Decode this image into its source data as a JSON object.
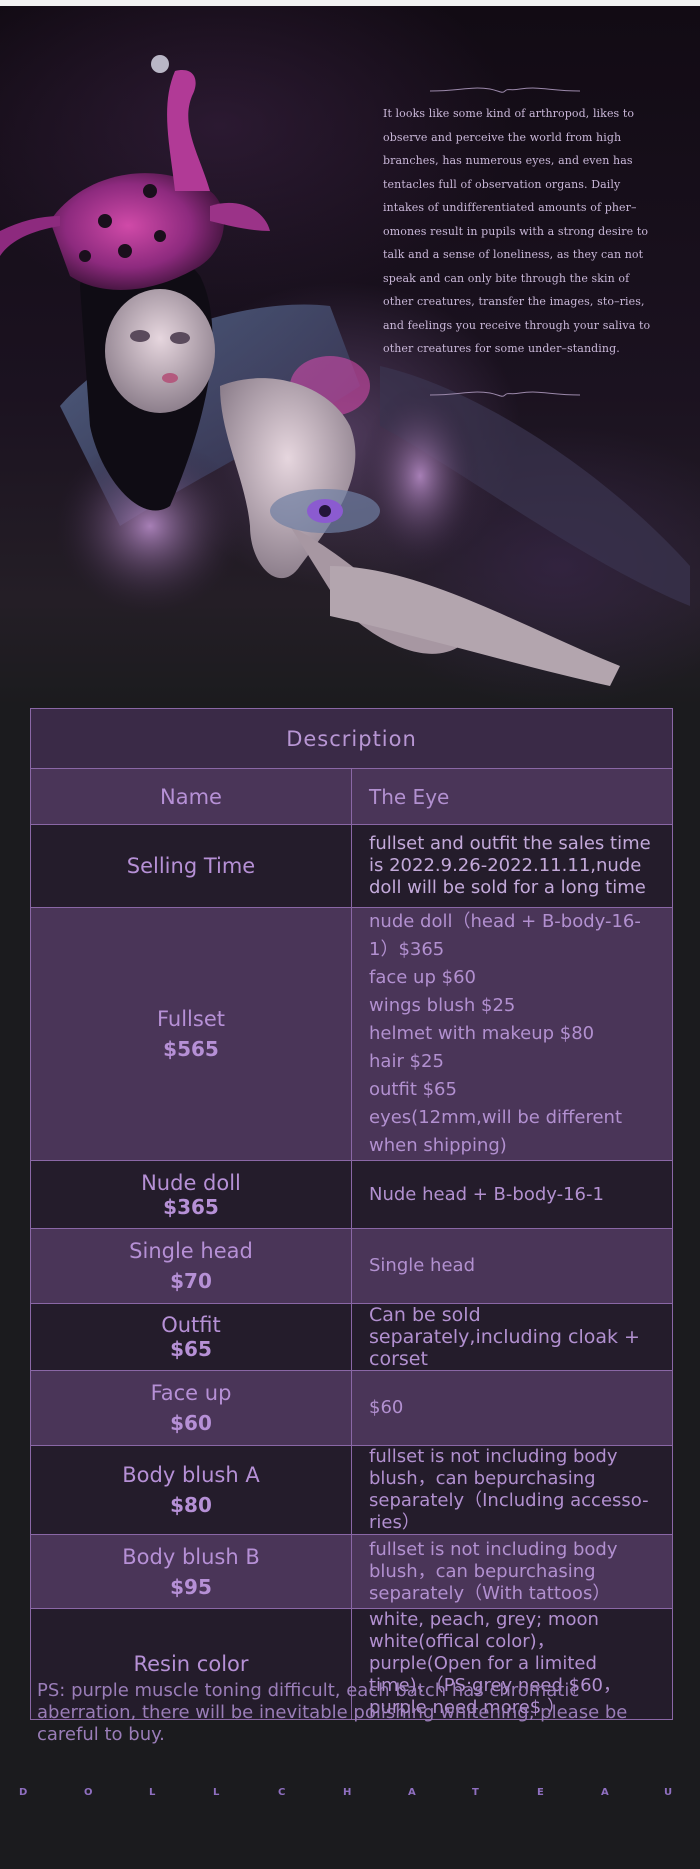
{
  "story": {
    "text": "It looks like some kind of arthropod, likes to observe and perceive the world from high branches, has numerous eyes, and even has tentacles full of observation organs. Daily intakes of undifferentiated amounts of pher–omones result in pupils with a strong desire to talk and a sense of loneliness, as they can not speak and can only bite through the skin of other creatures, transfer the images, sto–ries, and feelings you receive through your saliva to other creatures for some under–standing."
  },
  "table": {
    "heading": "Description",
    "name_label": "Name",
    "name_value": "The Eye",
    "selling_label": "Selling Time",
    "selling_value": "fullset and outfit the sales time is 2022.9.26-2022.11.11,nude doll will be sold for a long time",
    "fullset_label": "Fullset",
    "fullset_price": "$565",
    "fullset_items": [
      "nude doll（head + B-body-16-1）$365",
      "face up $60",
      "wings blush $25",
      "helmet with makeup $80",
      "hair $25",
      "outfit $65",
      "eyes(12mm,will be different when shipping)"
    ],
    "nude_label": "Nude doll",
    "nude_price": "$365",
    "nude_value": "Nude head + B-body-16-1",
    "head_label": "Single head",
    "head_price": "$70",
    "head_value": "Single head",
    "outfit_label": "Outfit",
    "outfit_price": "$65",
    "outfit_value": "Can be sold separately,including cloak + corset",
    "faceup_label": "Face up",
    "faceup_price": "$60",
    "faceup_value": "$60",
    "blushA_label": "Body blush A",
    "blushA_price": "$80",
    "blushA_value": "fullset is not including body blush，can bepurchasing separately（Including accesso-ries）",
    "blushB_label": "Body blush B",
    "blushB_price": "$95",
    "blushB_value": "fullset is not including body blush，can bepurchasing separately（With tattoos）",
    "resin_label": "Resin color",
    "resin_value": "white, peach, grey; moon white(offical color)，purple(Open for a limited time)、（PS:grey need $60，purple need more$ ）"
  },
  "footnote": "PS: purple muscle toning difficult, each batch has chromatic aberration, there will be inevitable polishing whitening, please be careful to buy.",
  "brand_letters": [
    "D",
    "O",
    "L",
    "L",
    "C",
    "H",
    "A",
    "T",
    "E",
    "A",
    "U"
  ],
  "colors": {
    "accent": "#b690d6",
    "row_light": "#4a3558",
    "row_dark": "#241c2b",
    "border": "#8a67a6"
  }
}
